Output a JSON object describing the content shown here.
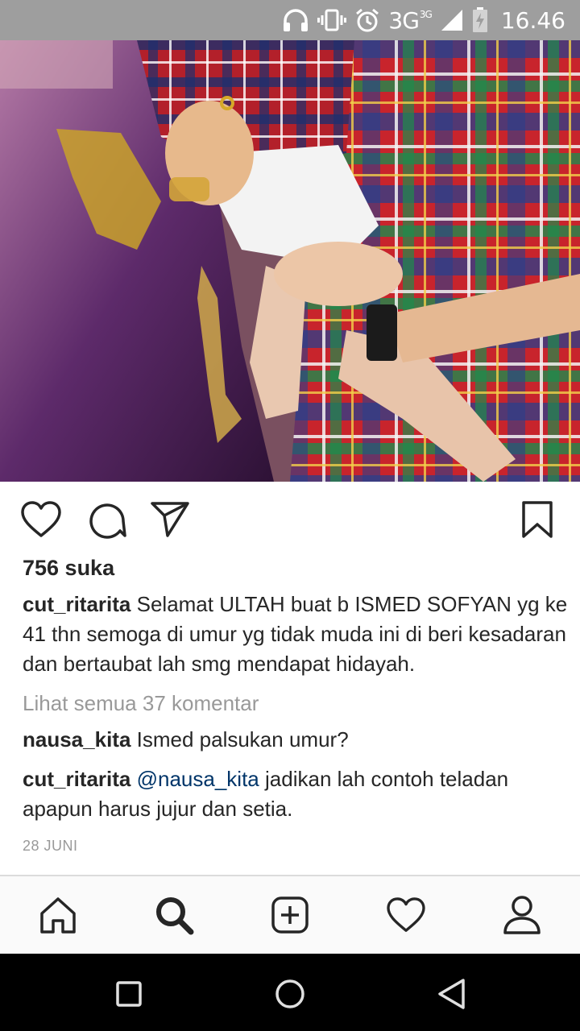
{
  "status_bar": {
    "network": "3G",
    "network_sup": "3G",
    "time": "16.46"
  },
  "post": {
    "likes": "756 suka",
    "caption": {
      "username": "cut_ritarita",
      "text": " Selamat ULTAH  buat b ISMED SOFYAN yg ke 41 thn semoga di umur yg tidak muda ini di beri kesadaran dan bertaubat lah smg mendapat hidayah."
    },
    "view_all_comments": "Lihat semua 37 komentar",
    "comments": [
      {
        "username": "nausa_kita",
        "text": " Ismed palsukan umur?"
      },
      {
        "username": "cut_ritarita",
        "mention": " @nausa_kita",
        "text": " jadikan lah contoh teladan apapun harus jujur dan setia."
      }
    ],
    "date": "28 JUNI"
  },
  "icons": {
    "status": [
      "headphones-icon",
      "vibrate-icon",
      "alarm-icon",
      "signal-icon",
      "battery-charging-icon"
    ],
    "actions": [
      "heart-icon",
      "comment-icon",
      "share-icon",
      "bookmark-icon"
    ],
    "bottom_nav": [
      "home-icon",
      "search-icon",
      "add-icon",
      "activity-heart-icon",
      "profile-icon"
    ],
    "system_nav": [
      "recents-icon",
      "home-circle-icon",
      "back-icon"
    ]
  }
}
